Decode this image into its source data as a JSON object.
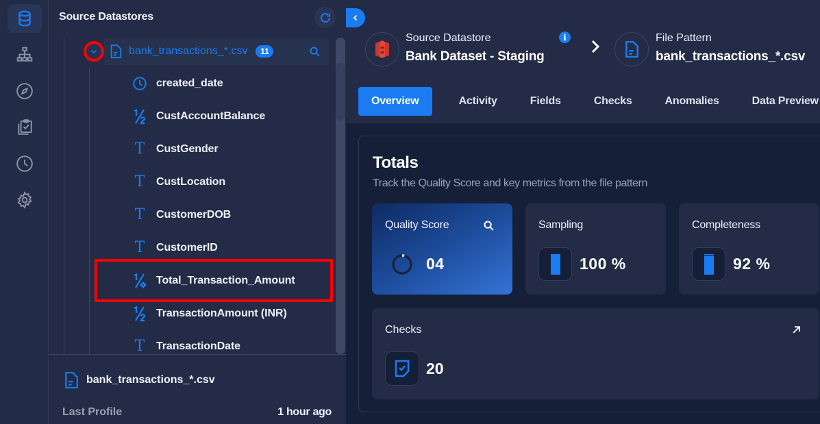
{
  "rail": {
    "items": [
      {
        "name": "datastores",
        "icon": "database-icon",
        "active": true
      },
      {
        "name": "explore",
        "icon": "sitemap-icon",
        "active": false
      },
      {
        "name": "discover",
        "icon": "compass-icon",
        "active": false
      },
      {
        "name": "checks",
        "icon": "clipboard-check-icon",
        "active": false
      },
      {
        "name": "history",
        "icon": "clock-icon",
        "active": false
      },
      {
        "name": "settings",
        "icon": "gear-icon",
        "active": false
      }
    ]
  },
  "tree": {
    "title": "Source Datastores",
    "file": {
      "name": "bank_transactions_*.csv",
      "count": "11",
      "icon": "file-icon"
    },
    "fields": [
      {
        "name": "created_date",
        "type_icon": "clock-icon"
      },
      {
        "name": "CustAccountBalance",
        "type_icon": "fraction-icon"
      },
      {
        "name": "CustGender",
        "type_icon": "text-type-icon"
      },
      {
        "name": "CustLocation",
        "type_icon": "text-type-icon"
      },
      {
        "name": "CustomerDOB",
        "type_icon": "text-type-icon"
      },
      {
        "name": "CustomerID",
        "type_icon": "text-type-icon"
      },
      {
        "name": "Total_Transaction_Amount",
        "type_icon": "computed-fraction-icon",
        "highlighted": true
      },
      {
        "name": "TransactionAmount (INR)",
        "type_icon": "fraction-icon"
      },
      {
        "name": "TransactionDate",
        "type_icon": "text-type-icon"
      }
    ],
    "footer": {
      "file_name": "bank_transactions_*.csv",
      "last_profile_label": "Last Profile",
      "last_profile_value": "1 hour ago"
    }
  },
  "header": {
    "datastore_label": "Source Datastore",
    "datastore_name": "Bank Dataset - Staging",
    "info_glyph": "i",
    "file_pattern_label": "File Pattern",
    "file_pattern_name": "bank_transactions_*.csv"
  },
  "tabs": [
    {
      "label": "Overview",
      "active": true
    },
    {
      "label": "Activity",
      "active": false
    },
    {
      "label": "Fields",
      "active": false
    },
    {
      "label": "Checks",
      "active": false
    },
    {
      "label": "Anomalies",
      "active": false
    },
    {
      "label": "Data Preview",
      "active": false
    }
  ],
  "totals": {
    "title": "Totals",
    "subtitle": "Track the Quality Score and key metrics from the file pattern",
    "quality_score": {
      "label": "Quality Score",
      "value": "04",
      "fraction": 0.04
    },
    "sampling": {
      "label": "Sampling",
      "value": "100 %",
      "fraction": 1.0
    },
    "completeness": {
      "label": "Completeness",
      "value": "92 %",
      "fraction": 0.92
    },
    "checks": {
      "label": "Checks",
      "value": "20"
    }
  },
  "colors": {
    "accent": "#1a7cf0",
    "highlight": "#ff0000",
    "panel": "#232b47",
    "background": "#161f38"
  }
}
